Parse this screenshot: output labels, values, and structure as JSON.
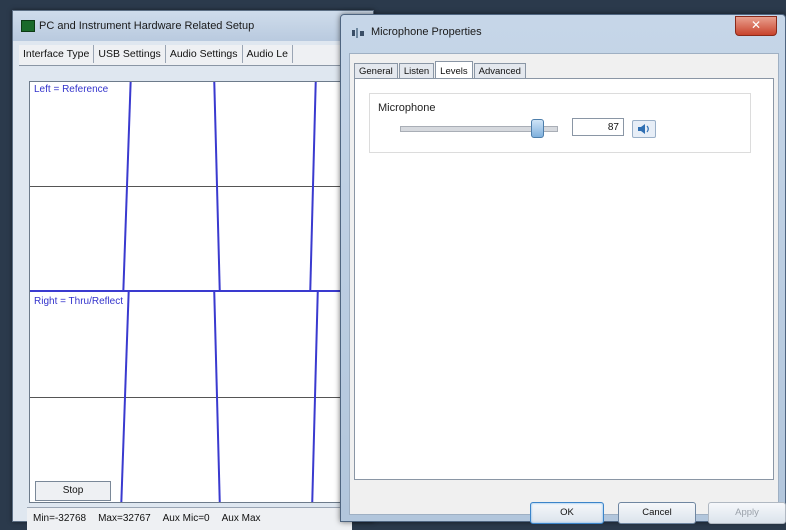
{
  "background_window": {
    "title": "PC and Instrument Hardware Related Setup",
    "tabs": [
      "Interface Type",
      "USB Settings",
      "Audio Settings",
      "Audio Le"
    ],
    "scope": {
      "top_label": "Left = Reference",
      "bottom_label": "Right = Thru/Reflect"
    },
    "stop_label": "Stop",
    "status": [
      "Min=-32768",
      "Max=32767",
      "Aux Mic=0",
      "Aux Max"
    ]
  },
  "dialog": {
    "title": "Microphone Properties",
    "close_glyph": "✕",
    "tabs": [
      "General",
      "Listen",
      "Levels",
      "Advanced"
    ],
    "active_tab": "Levels",
    "levels": {
      "label": "Microphone",
      "value": "87",
      "slider_fraction": 0.87
    },
    "buttons": {
      "ok": "OK",
      "cancel": "Cancel",
      "apply": "Apply"
    }
  },
  "colors": {
    "trace": "#3a3acf",
    "dialog_frame": "#b2c6dc",
    "close": "#c8432c"
  },
  "icons": {
    "app": "app-icon",
    "dialog": "microphone-icon",
    "mute": "speaker-icon"
  }
}
